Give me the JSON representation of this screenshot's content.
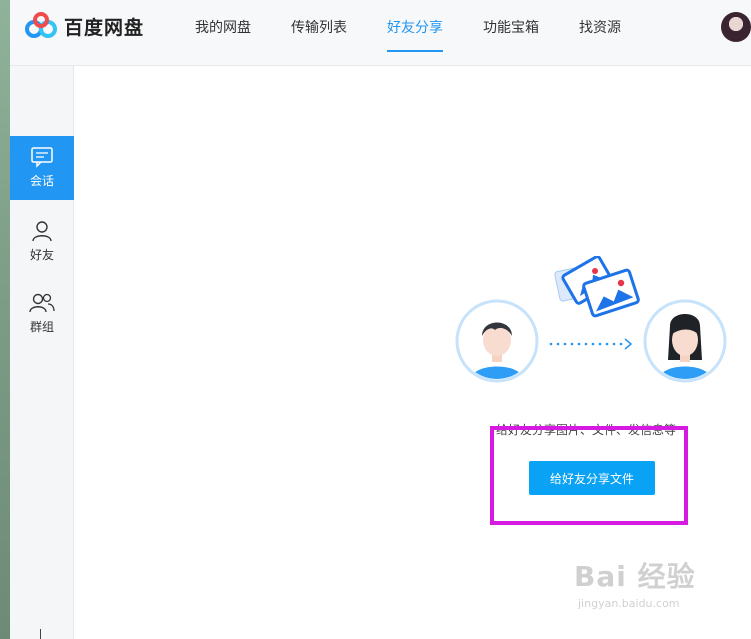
{
  "app": {
    "title": "百度网盘"
  },
  "nav": {
    "items": [
      {
        "label": "我的网盘",
        "active": false
      },
      {
        "label": "传输列表",
        "active": false
      },
      {
        "label": "好友分享",
        "active": true
      },
      {
        "label": "功能宝箱",
        "active": false
      },
      {
        "label": "找资源",
        "active": false
      }
    ]
  },
  "sidebar": {
    "items": [
      {
        "label": "会话",
        "icon": "chat-icon",
        "active": true
      },
      {
        "label": "好友",
        "icon": "user-icon",
        "active": false
      },
      {
        "label": "群组",
        "icon": "group-icon",
        "active": false
      }
    ]
  },
  "main": {
    "hint": "给好友分享图片、文件、发信息等",
    "share_button": "给好友分享文件"
  },
  "watermark": {
    "main": "Bai 经验",
    "sub": "jingyan.baidu.com"
  },
  "colors": {
    "accent": "#2196f3",
    "button": "#0aa2f5",
    "highlight": "#d61ae0"
  }
}
